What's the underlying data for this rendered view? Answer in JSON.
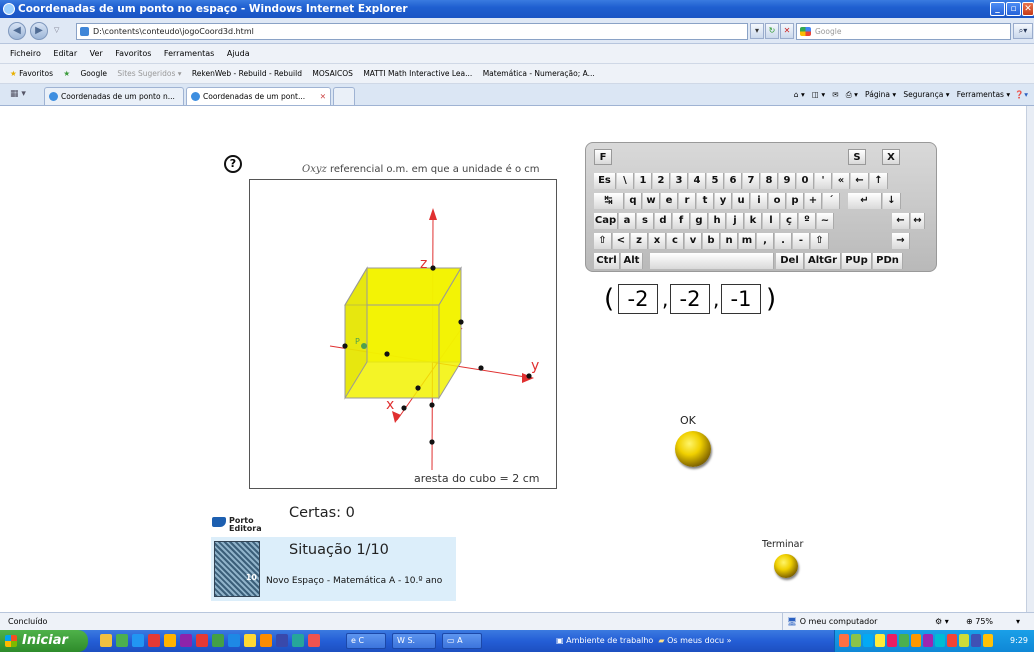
{
  "window": {
    "title": "Coordenadas de um ponto no espaço - Windows Internet Explorer"
  },
  "address_bar": {
    "url": "D:\\contents\\conteudo\\jogoCoord3d.html",
    "search_placeholder": "Google"
  },
  "menu": [
    "Ficheiro",
    "Editar",
    "Ver",
    "Favoritos",
    "Ferramentas",
    "Ajuda"
  ],
  "favorites": {
    "label": "Favoritos",
    "items": [
      "Google",
      "Sites Sugeridos ▾",
      "RekenWeb - Rebuild - Rebuild",
      "MOSAICOS",
      "MATTI Math Interactive Lea...",
      "Matemática - Numeração; A..."
    ]
  },
  "tabs": [
    {
      "label": "Coordenadas de um ponto n..."
    },
    {
      "label": "Coordenadas de um pont...",
      "close": "✕"
    }
  ],
  "tab_tools": [
    "Página ▾",
    "Segurança ▾",
    "Ferramentas ▾"
  ],
  "app": {
    "help_symbol": "?",
    "ref_caption_math": "Oxyz",
    "ref_caption_text": " referencial o.m. em que a unidade é o cm",
    "aresta": "aresta do cubo = 2 cm",
    "axes": {
      "x": "x",
      "y": "y",
      "z": "z"
    },
    "point_label": "P",
    "cube_color": "#f5f500",
    "keyboard": {
      "top": {
        "f": "F",
        "s": "S",
        "x": "X"
      },
      "rows": [
        [
          "Es",
          "\\",
          "1",
          "2",
          "3",
          "4",
          "5",
          "6",
          "7",
          "8",
          "9",
          "0",
          "'",
          "«",
          "←",
          "↑"
        ],
        [
          "↹",
          "q",
          "w",
          "e",
          "r",
          "t",
          "y",
          "u",
          "i",
          "o",
          "p",
          "+",
          "´",
          "↵",
          "↓"
        ],
        [
          "Cap",
          "a",
          "s",
          "d",
          "f",
          "g",
          "h",
          "j",
          "k",
          "l",
          "ç",
          "º",
          "~",
          "←",
          "↔"
        ],
        [
          "⇧",
          "<",
          "z",
          "x",
          "c",
          "v",
          "b",
          "n",
          "m",
          ",",
          ".",
          "-",
          "⇧",
          "→"
        ],
        [
          "Ctrl",
          "Alt",
          "Del",
          "AltGr",
          "PUp",
          "PDn"
        ]
      ]
    },
    "coordinates": {
      "open": "(",
      "values": [
        "-2",
        "-2",
        "-1"
      ],
      "sep": ",",
      "close": ")"
    },
    "ok_label": "OK",
    "terminar_label": "Terminar",
    "certas": "Certas: 0",
    "situacao": "Situação 1/10",
    "publisher": {
      "line1": "Porto",
      "line2": "Editora"
    },
    "book_title": "Novo Espaço - Matemática A - 10.º ano",
    "book_badge": "10"
  },
  "status_bar": {
    "left": "Concluído",
    "zone": "O meu computador",
    "zoom": "75%"
  },
  "taskbar": {
    "start": "Iniciar",
    "items": [
      "C",
      "S.",
      "A"
    ],
    "desktop": "Ambiente de trabalho",
    "docs": "Os meus docu",
    "clock": "9:29"
  }
}
